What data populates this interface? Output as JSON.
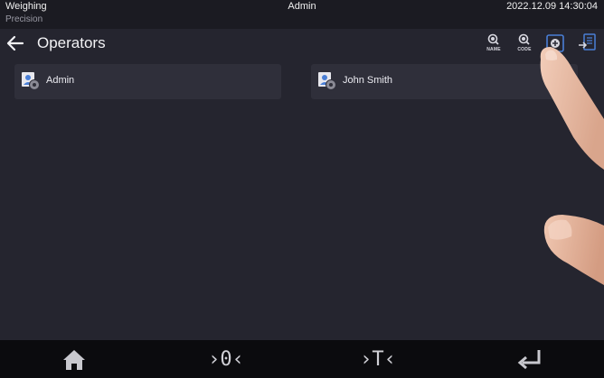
{
  "statusbar": {
    "app_name": "Weighing",
    "mode": "Precision",
    "user": "Admin",
    "datetime": "2022.12.09 14:30:04"
  },
  "header": {
    "title": "Operators",
    "back_icon": "arrow-left-icon",
    "tools": [
      {
        "icon": "search-by-name-icon",
        "label": "NAME"
      },
      {
        "icon": "search-by-code-icon",
        "label": "CODE"
      },
      {
        "icon": "add-icon"
      },
      {
        "icon": "export-icon"
      }
    ]
  },
  "operators": [
    {
      "name": "Admin",
      "icon": "operator-icon"
    },
    {
      "name": "John Smith",
      "icon": "operator-icon"
    }
  ],
  "navbar": {
    "home_icon": "home-icon",
    "zero_glyph": "›0‹",
    "tare_glyph": "›T‹",
    "enter_icon": "enter-icon"
  },
  "colors": {
    "background": "#25252f",
    "statusbar": "#1b1b22",
    "tile": "#2f2f3a",
    "navbar": "#0b0b0e",
    "accent": "#4a7fd6"
  }
}
